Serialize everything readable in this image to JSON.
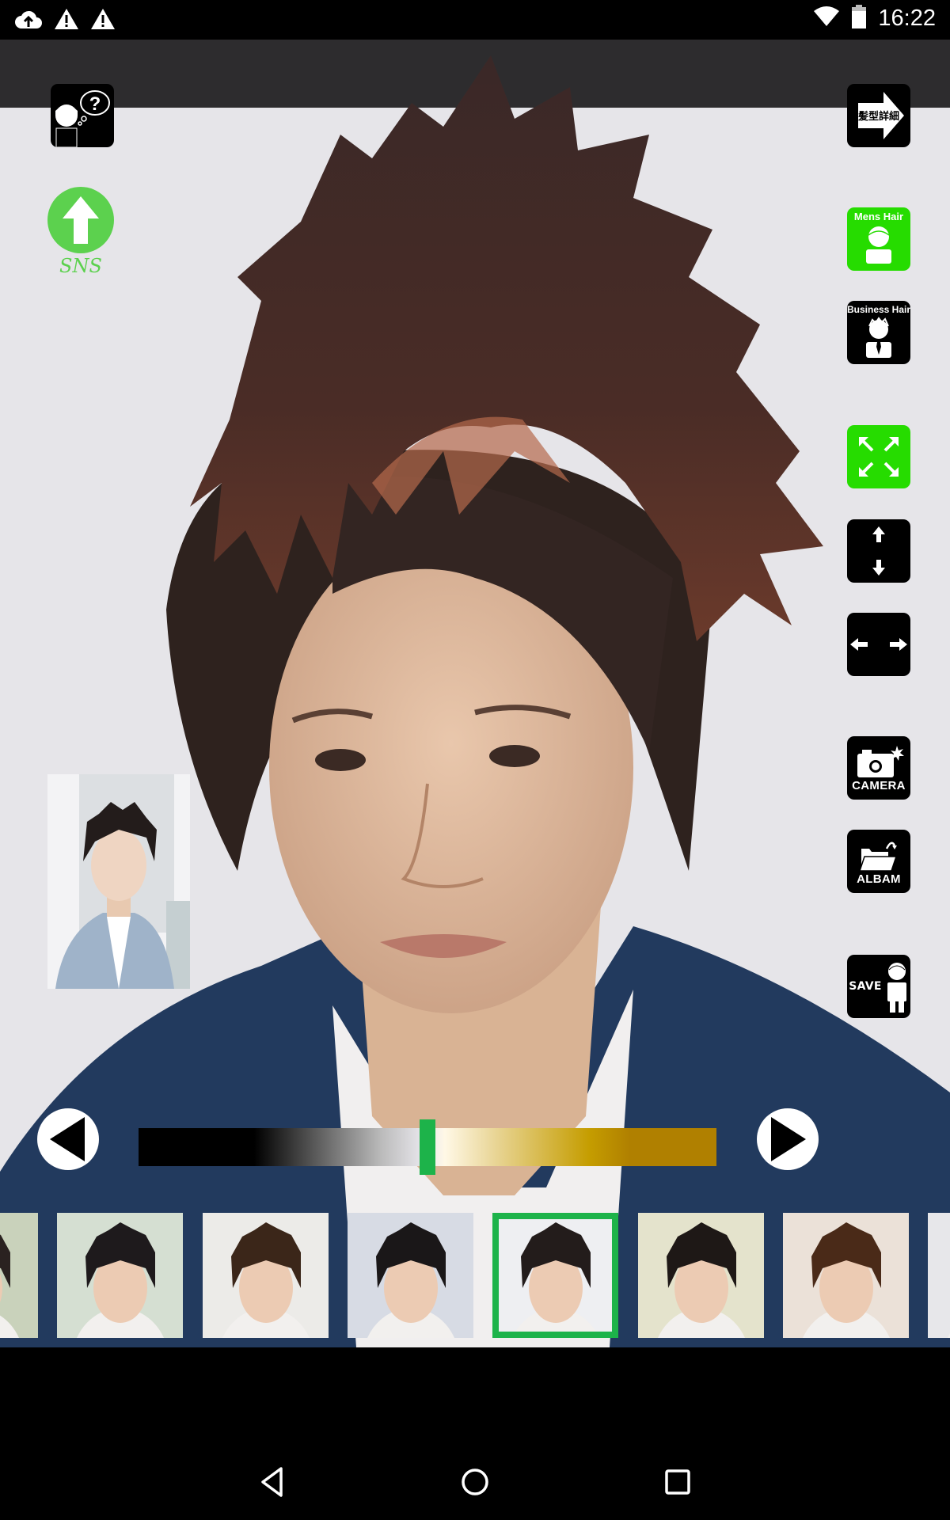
{
  "status_bar": {
    "time": "16:22",
    "left_icons": [
      "cloud-upload-icon",
      "warning-icon",
      "warning-icon"
    ],
    "right_icons": [
      "wifi-icon",
      "battery-icon"
    ]
  },
  "left_panel": {
    "help_button": {
      "icon": "help-thought-icon"
    },
    "sns_button": {
      "label": "SNS",
      "icon": "upload-arrow-icon"
    },
    "reference_photo": {
      "alt": "selected hairstyle model photo"
    }
  },
  "right_panel": {
    "hairstyle_details": {
      "label": "髪型詳細",
      "icon": "arrow-right-icon"
    },
    "mens_hair": {
      "label": "Mens Hair",
      "active": true
    },
    "business_hair": {
      "label": "Business Hair",
      "active": false
    },
    "resize": {
      "icon": "expand-icon",
      "active": true
    },
    "vertical_stretch": {
      "icon": "vertical-arrows-icon"
    },
    "horizontal_stretch": {
      "icon": "horizontal-arrows-icon"
    },
    "camera": {
      "label": "CAMERA"
    },
    "album": {
      "label": "ALBAM"
    },
    "save": {
      "label": "SAVE"
    }
  },
  "color_slider": {
    "value": 0.5,
    "gradient": [
      "#000000",
      "#eceaf0",
      "#c59d00",
      "#b08000"
    ],
    "thumb_color": "#1db34a"
  },
  "thumbnails": {
    "selected_index": 4,
    "items": [
      {
        "name": "hairstyle-1",
        "hair": "#2a2220",
        "bg": "#c9d2bb"
      },
      {
        "name": "hairstyle-2",
        "hair": "#1e1a1c",
        "bg": "#d5dfd2"
      },
      {
        "name": "hairstyle-3",
        "hair": "#3b2619",
        "bg": "#ecebe8"
      },
      {
        "name": "hairstyle-4",
        "hair": "#1a1718",
        "bg": "#d7dbe4"
      },
      {
        "name": "hairstyle-5",
        "hair": "#231c1b",
        "bg": "#eeeff2"
      },
      {
        "name": "hairstyle-6",
        "hair": "#1e1816",
        "bg": "#e4e3cc"
      },
      {
        "name": "hairstyle-7",
        "hair": "#4a2a18",
        "bg": "#ebe1d8"
      },
      {
        "name": "hairstyle-8",
        "hair": "#2a2220",
        "bg": "#e7e7ea"
      }
    ]
  },
  "colors": {
    "accent_green": "#26dc00",
    "selection_green": "#1db34a",
    "sns_green": "#5cd14e",
    "background": "#e6e5e9",
    "top_band": "#2d2c2e"
  }
}
